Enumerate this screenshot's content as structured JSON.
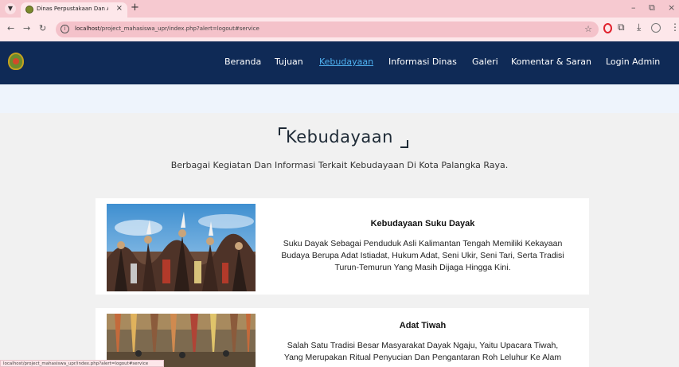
{
  "browser": {
    "tab_title": "Dinas Perpustakaan Dan Arsip K...",
    "url_host": "localhost",
    "url_path": "/project_mahasiswa_upr/index.php?alert=logout#service",
    "status_text": "localhost/project_mahasiswa_upr/index.php?alert=logout#service"
  },
  "nav": {
    "items": [
      "Beranda",
      "Tujuan",
      "Kebudayaan",
      "Informasi Dinas",
      "Galeri",
      "Komentar & Saran",
      "Login Admin"
    ],
    "active": "Kebudayaan"
  },
  "section": {
    "title": "Kebudayaan",
    "subtitle": "Berbagai Kegiatan Dan Informasi Terkait Kebudayaan Di Kota Palangka Raya."
  },
  "cards": [
    {
      "title": "Kebudayaan Suku Dayak",
      "lines": [
        "Suku Dayak Sebagai Penduduk Asli Kalimantan Tengah Memiliki Kekayaan",
        "Budaya Berupa Adat Istiadat, Hukum Adat, Seni Ukir, Seni Tari, Serta Tradisi",
        "Turun-Temurun Yang Masih Dijaga Hingga Kini."
      ]
    },
    {
      "title": "Adat Tiwah",
      "lines": [
        "Salah Satu Tradisi Besar Masyarakat Dayak Ngaju, Yaitu Upacara Tiwah,",
        "Yang Merupakan Ritual Penyucian Dan Pengantaran Roh Leluhur Ke Alam"
      ]
    }
  ],
  "colors": {
    "navbar": "#0f2a56",
    "nav_active": "#4fb1f0",
    "tabbar": "#f6c9d0"
  }
}
